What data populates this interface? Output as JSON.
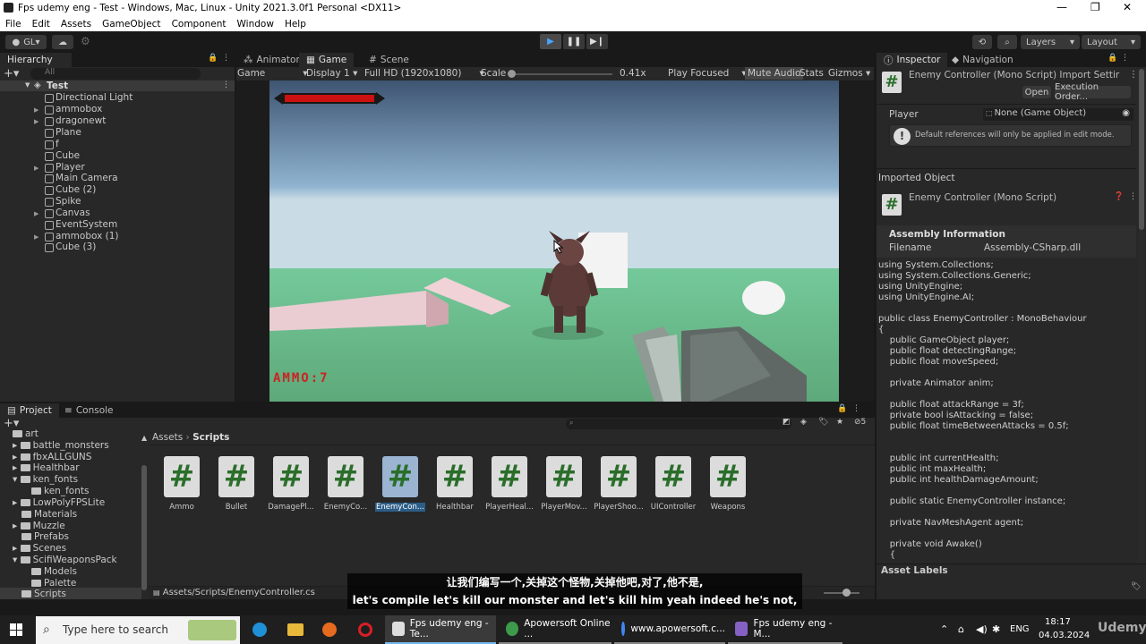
{
  "window": {
    "title": "Fps udemy eng - Test - Windows, Mac, Linux - Unity 2021.3.0f1 Personal <DX11>",
    "minimize": "—",
    "maximize": "❐",
    "close": "✕"
  },
  "menu": [
    "File",
    "Edit",
    "Assets",
    "GameObject",
    "Component",
    "Window",
    "Help"
  ],
  "toolbar": {
    "gl_label": "GL",
    "layers_label": "Layers",
    "layout_label": "Layout"
  },
  "hierarchy": {
    "tab": "Hierarchy",
    "search_placeholder": "All",
    "scene": "Test",
    "items": [
      "Directional Light",
      "ammobox",
      "dragonewt",
      "Plane",
      "f",
      "Cube",
      "Player",
      "Main Camera",
      "Cube (2)",
      "Spike",
      "Canvas",
      "EventSystem",
      "ammobox (1)",
      "Cube (3)"
    ]
  },
  "game": {
    "tabs": [
      "Animator",
      "Game",
      "Scene"
    ],
    "mode": "Game",
    "display": "Display 1",
    "resolution": "Full HD (1920x1080)",
    "scale_label": "Scale",
    "scale_value": "0.41x",
    "play_focus": "Play Focused",
    "mute": "Mute Audio",
    "stats": "Stats",
    "gizmos": "Gizmos",
    "ammo_text": "AMMO:7"
  },
  "inspector": {
    "tabs": [
      "Inspector",
      "Navigation"
    ],
    "header_title": "Enemy Controller (Mono Script) Import Settir",
    "open_button": "Open",
    "exec_button": "Execution Order...",
    "player_label": "Player",
    "player_value": "None (Game Object)",
    "info_text": "Default references will only be applied in edit mode.",
    "imported_object": "Imported Object",
    "script_name": "Enemy Controller (Mono Script)",
    "assembly_info": "Assembly Information",
    "filename_label": "Filename",
    "filename_value": "Assembly-CSharp.dll",
    "code": "using System.Collections;\nusing System.Collections.Generic;\nusing UnityEngine;\nusing UnityEngine.AI;\n\npublic class EnemyController : MonoBehaviour\n{\n    public GameObject player;\n    public float detectingRange;\n    public float moveSpeed;\n\n    private Animator anim;\n\n    public float attackRange = 3f;\n    private bool isAttacking = false;\n    public float timeBetweenAttacks = 0.5f;\n\n\n    public int currentHealth;\n    public int maxHealth;\n    public int healthDamageAmount;\n\n    public static EnemyController instance;\n\n    private NavMeshAgent agent;\n\n    private void Awake()\n    {",
    "asset_labels": "Asset Labels"
  },
  "project": {
    "tabs": [
      "Project",
      "Console"
    ],
    "hidden_count": "5",
    "breadcrumb": [
      "Assets",
      "Scripts"
    ],
    "folders": [
      "art",
      "battle_monsters",
      "fbxALLGUNS",
      "Healthbar",
      "ken_fonts",
      "ken_fonts",
      "LowPolyFPSLite",
      "Materials",
      "Muzzle",
      "Prefabs",
      "Scenes",
      "ScifiWeaponsPack",
      "Models",
      "Palette",
      "Scripts"
    ],
    "assets": [
      "Ammo",
      "Bullet",
      "DamagePl...",
      "EnemyCo...",
      "EnemyCon...",
      "Healthbar",
      "PlayerHeal...",
      "PlayerMov...",
      "PlayerShoo...",
      "UIController",
      "Weapons"
    ],
    "path": "Assets/Scripts/EnemyController.cs"
  },
  "subtitles": {
    "zh": "让我们编写一个,关掉这个怪物,关掉他吧,对了,他不是,",
    "en": "let's compile let's kill our monster and let's kill him yeah indeed he's not,"
  },
  "taskbar": {
    "search_placeholder": "Type here to search",
    "apps": [
      "Fps udemy eng - Te...",
      "Apowersoft Online ...",
      "www.apowersoft.c...",
      "Fps udemy eng - M..."
    ],
    "lang": "ENG",
    "time": "18:17",
    "date": "04.03.2024",
    "watermark": "Udemy"
  },
  "colors": {
    "accent": "#4aa3ff",
    "health_bar": "#cc1111",
    "ammo_text": "#cc2222",
    "selection": "#2c5d87"
  }
}
